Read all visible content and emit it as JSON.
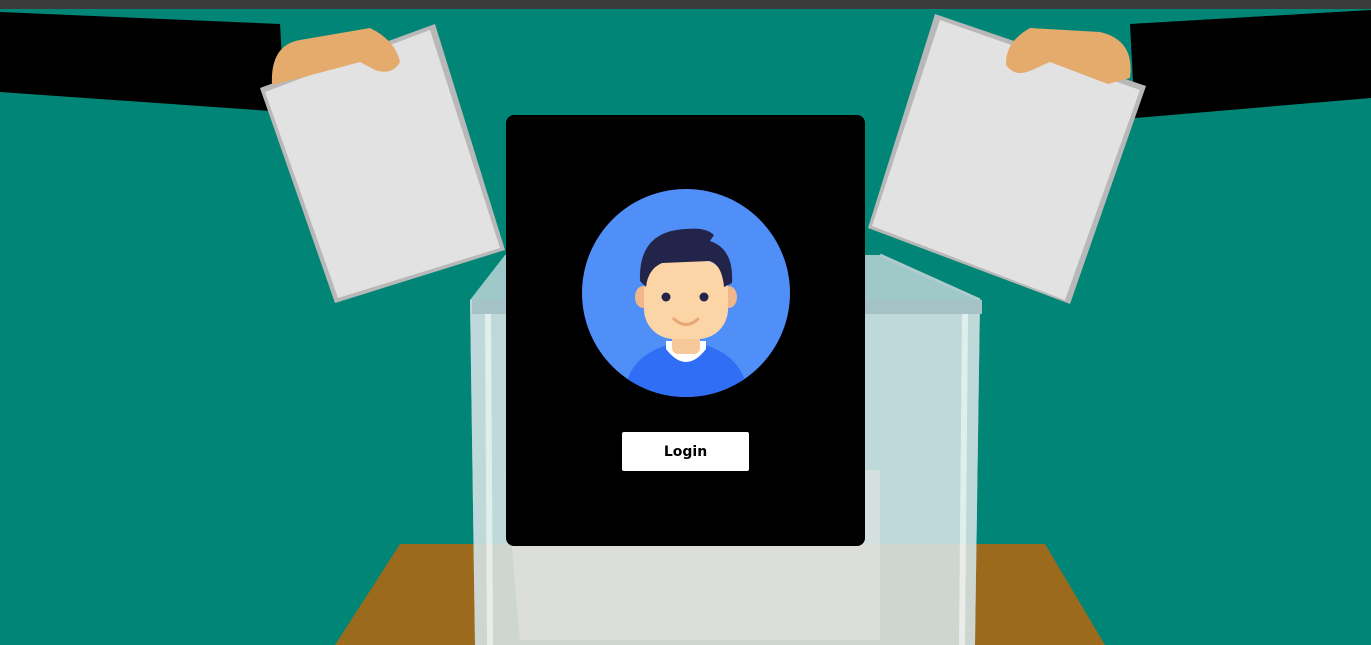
{
  "login": {
    "button_label": "Login"
  },
  "colors": {
    "background": "#008577",
    "card": "#000000",
    "avatar_circle": "#4f8ff7",
    "button": "#ffffff"
  },
  "icons": {
    "avatar": "user-avatar-icon"
  }
}
